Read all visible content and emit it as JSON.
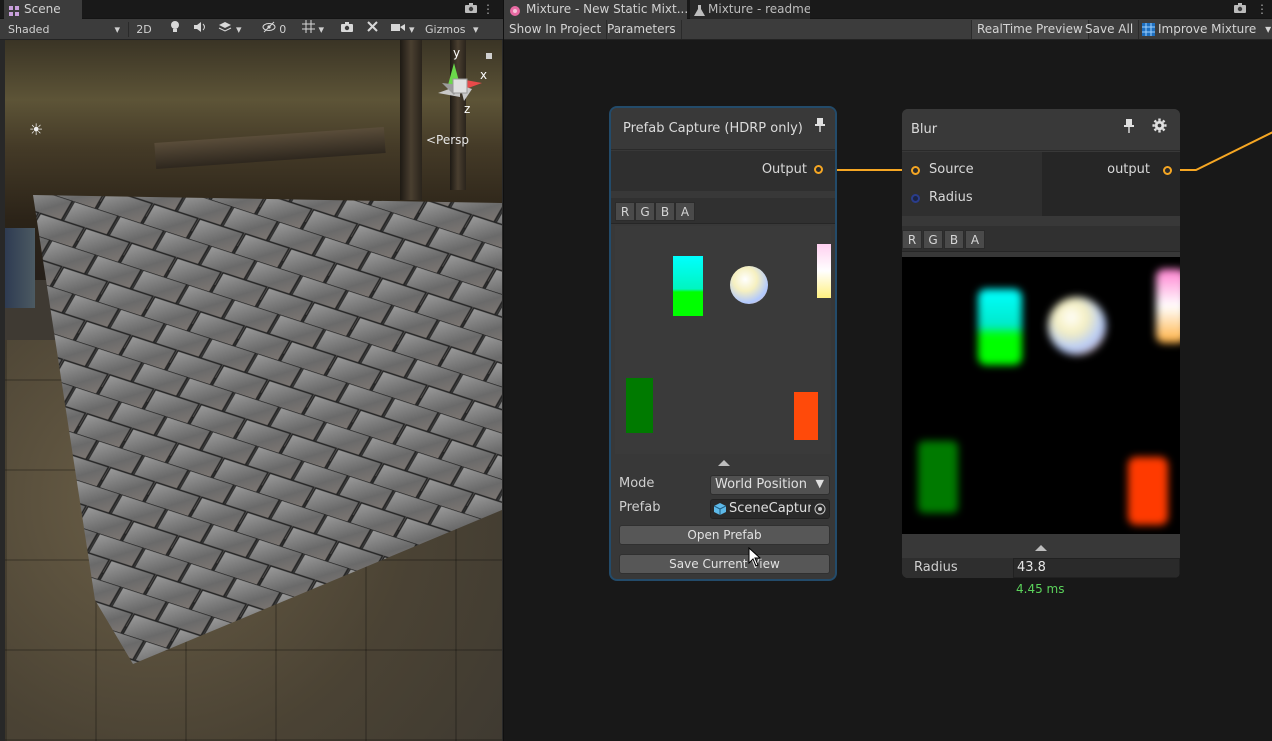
{
  "scene": {
    "tab_label": "Scene",
    "shading_mode": "Shaded",
    "btn_2d": "2D",
    "hidden_count": "0",
    "gizmos_label": "Gizmos",
    "gizmo_axis_y": "y",
    "gizmo_axis_x": "x",
    "gizmo_axis_z": "z",
    "projection_label": "<Persp"
  },
  "mixture": {
    "tab_active": "Mixture - New Static Mixt...",
    "tab_readme": "Mixture - readme",
    "toolbar": {
      "show_in_project": "Show In Project",
      "parameters": "Parameters",
      "realtime_preview": "RealTime Preview",
      "save_all": "Save All",
      "improve_mixture": "Improve Mixture"
    },
    "prefab_node": {
      "title": "Prefab Capture (HDRP only)",
      "output_label": "Output",
      "channels": [
        "R",
        "G",
        "B",
        "A"
      ],
      "mode_label": "Mode",
      "mode_value": "World Position",
      "prefab_label": "Prefab",
      "prefab_value": "SceneCapture",
      "open_prefab_button": "Open Prefab",
      "save_view_button": "Save Current View"
    },
    "blur_node": {
      "title": "Blur",
      "source_label": "Source",
      "radius_port_label": "Radius",
      "output_label": "output",
      "channels": [
        "R",
        "G",
        "B",
        "A"
      ],
      "radius_label": "Radius",
      "radius_value": "43.8",
      "timing": "4.45 ms"
    }
  },
  "colors": {
    "port_orange": "#f5a623",
    "port_blue": "#2a3d8c",
    "timing_green": "#5bd35b",
    "selection_outline": "#234b6a"
  }
}
